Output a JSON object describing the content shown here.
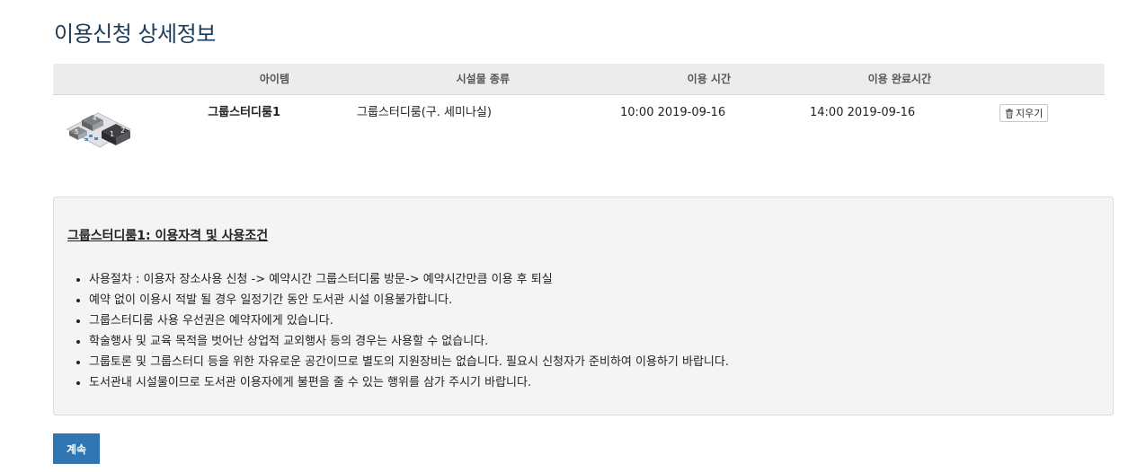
{
  "page": {
    "title": "이용신청 상세정보"
  },
  "table": {
    "headers": {
      "item": "아이템",
      "facility_type": "시설물 종류",
      "use_time": "이용 시간",
      "end_time": "이용 완료시간"
    },
    "rows": [
      {
        "item": "그룹스터디룸1",
        "facility_type": "그룹스터디룸(구. 세미나실)",
        "use_time": "10:00 2019-09-16",
        "end_time": "14:00 2019-09-16",
        "delete_label": "지우기",
        "thumb_numbers": [
          "4",
          "5",
          "6",
          "1",
          "2"
        ]
      }
    ]
  },
  "info": {
    "heading": "그룹스터디룸1: 이용자격 및 사용조건",
    "rules": [
      "사용절차 : 이용자 장소사용 신청 -> 예약시간 그룹스터디룸 방문-> 예약시간만큼 이용 후 퇴실",
      "예약 없이 이용시 적발 될 경우 일정기간 동안 도서관 시설 이용불가합니다.",
      "그룹스터디룸 사용 우선권은 예약자에게 있습니다.",
      "학술행사 및 교육 목적을 벗어난 상업적 교외행사 등의 경우는 사용할 수 없습니다.",
      "그룹토론 및 그룹스터디 등을 위한 자유로운 공간이므로 별도의 지원장비는 없습니다. 필요시 신청자가 준비하여 이용하기 바랍니다.",
      "도서관내 시설물이므로 도서관 이용자에게 불편을 줄 수 있는 행위를 삼가 주시기 바랍니다."
    ]
  },
  "actions": {
    "continue_label": "계속"
  },
  "icons": {
    "delete": "trash-icon"
  },
  "colors": {
    "title": "#1b3a57",
    "primary_button": "#2f76b3",
    "header_bg": "#ececec",
    "info_bg": "#f4f4f4"
  }
}
